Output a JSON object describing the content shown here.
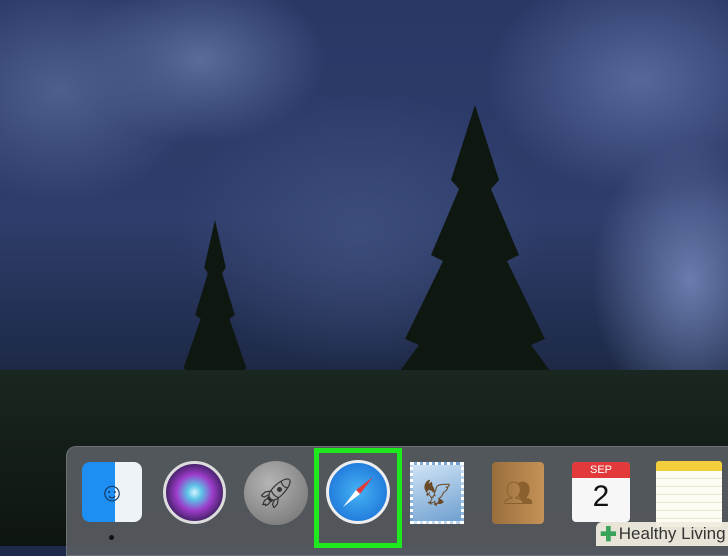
{
  "desktop": {
    "wallpaper": "dark blue mountain valley with pine trees at dusk"
  },
  "dock": {
    "items": [
      {
        "name": "Finder",
        "icon": "finder-icon",
        "running": true
      },
      {
        "name": "Siri",
        "icon": "siri-icon"
      },
      {
        "name": "Launchpad",
        "icon": "rocket-icon"
      },
      {
        "name": "Safari",
        "icon": "compass-icon",
        "highlighted": true
      },
      {
        "name": "Mail",
        "icon": "stamp-eagle-icon"
      },
      {
        "name": "Contacts",
        "icon": "contacts-book-icon"
      },
      {
        "name": "Calendar",
        "icon": "calendar-icon",
        "month": "SEP",
        "day": "2"
      },
      {
        "name": "Notes",
        "icon": "notepad-icon"
      }
    ],
    "highlight_color": "#1ee81e"
  },
  "watermark": {
    "text": "Healthy Living"
  }
}
